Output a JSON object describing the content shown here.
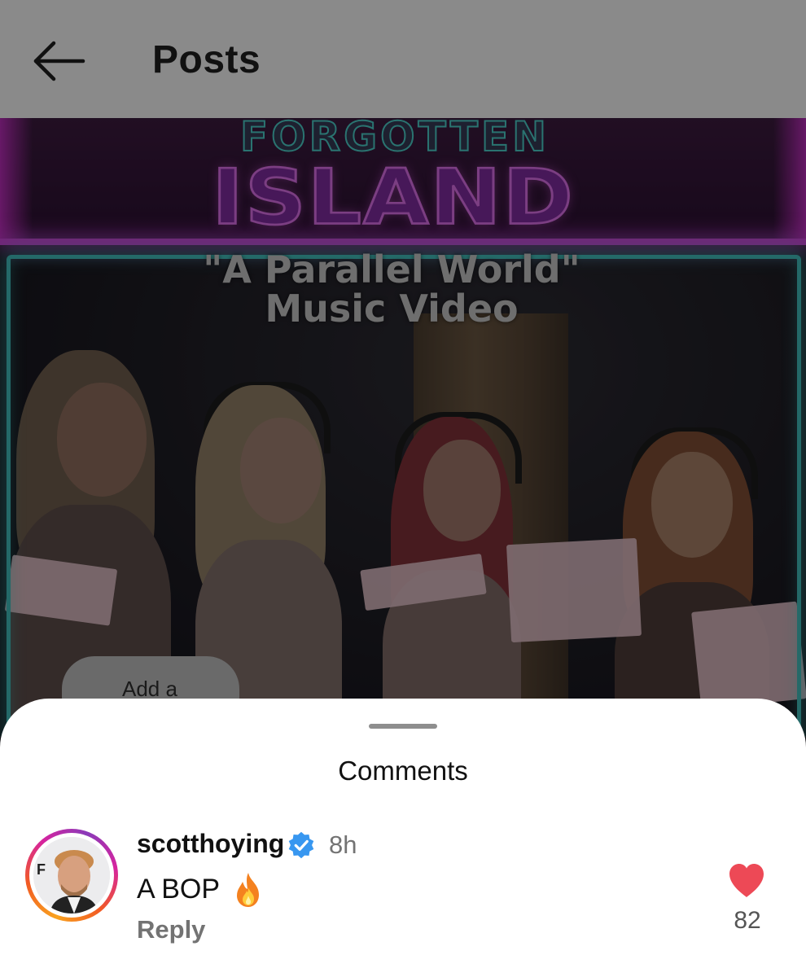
{
  "header": {
    "title": "Posts",
    "back_icon": "arrow-left-icon"
  },
  "post": {
    "headline_top": "FORGOTTEN",
    "headline_main": "ISLAND",
    "video_title_line1": "\"A Parallel World\"",
    "video_title_line2": "Music Video",
    "add_pill_text": "Add a"
  },
  "comments": {
    "title": "Comments",
    "items": [
      {
        "username": "scotthoying",
        "verified": true,
        "time": "8h",
        "text": "A BOP",
        "emoji_icon": "fire-icon",
        "reply_label": "Reply",
        "like_icon": "heart-icon",
        "likes": "82",
        "liked": true
      }
    ]
  },
  "colors": {
    "header_bg": "#8a8a8a",
    "verified_blue": "#3897f0",
    "like_red": "#ed4956",
    "secondary_text": "#737373"
  }
}
